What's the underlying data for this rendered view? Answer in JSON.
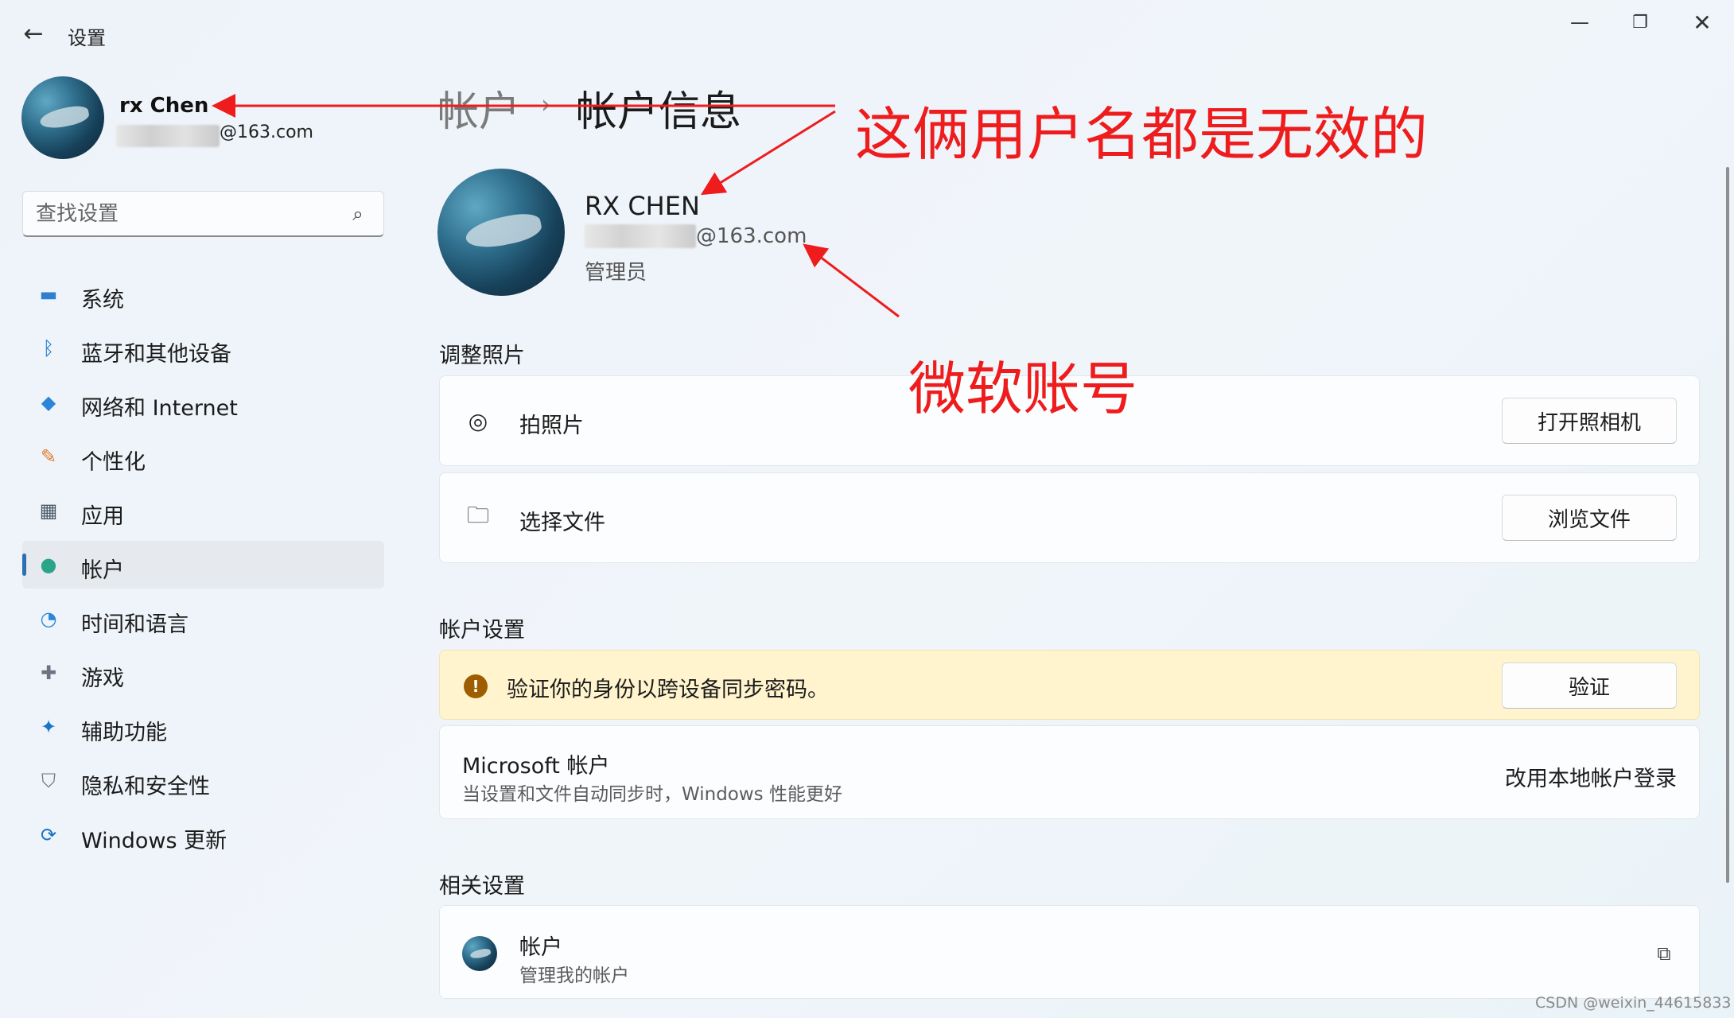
{
  "window": {
    "title": "设置",
    "controls": {
      "minimize": "—",
      "maximize": "❐",
      "close": "✕"
    }
  },
  "user": {
    "name": "rx Chen",
    "email_suffix": "@163.com"
  },
  "search": {
    "placeholder": "查找设置"
  },
  "nav": {
    "items": [
      {
        "label": "系统",
        "icon": "system-icon",
        "glyph": "▬",
        "color": "#2f7fd1"
      },
      {
        "label": "蓝牙和其他设备",
        "icon": "bluetooth-icon",
        "glyph": "ᛒ",
        "color": "#1a73c8"
      },
      {
        "label": "网络和 Internet",
        "icon": "wifi-icon",
        "glyph": "◆",
        "color": "#2a86d8"
      },
      {
        "label": "个性化",
        "icon": "brush-icon",
        "glyph": "✎",
        "color": "#e07a2a"
      },
      {
        "label": "应用",
        "icon": "apps-icon",
        "glyph": "▦",
        "color": "#4a5a6a"
      },
      {
        "label": "帐户",
        "icon": "account-icon",
        "glyph": "●",
        "color": "#2ba58a",
        "active": true
      },
      {
        "label": "时间和语言",
        "icon": "clock-icon",
        "glyph": "◔",
        "color": "#2a86d8"
      },
      {
        "label": "游戏",
        "icon": "gamepad-icon",
        "glyph": "✚",
        "color": "#6a7480"
      },
      {
        "label": "辅助功能",
        "icon": "accessibility-icon",
        "glyph": "✦",
        "color": "#1a73c8"
      },
      {
        "label": "隐私和安全性",
        "icon": "shield-icon",
        "glyph": "⛉",
        "color": "#6a7480"
      },
      {
        "label": "Windows 更新",
        "icon": "update-icon",
        "glyph": "⟳",
        "color": "#1a73c8"
      }
    ]
  },
  "header": {
    "breadcrumb_parent": "帐户",
    "breadcrumb_sep": "›",
    "title": "帐户信息"
  },
  "account": {
    "name": "RX CHEN",
    "email_suffix": "@163.com",
    "role": "管理员"
  },
  "sections": {
    "photo": {
      "title": "调整照片",
      "take_photo": {
        "label": "拍照片",
        "button": "打开照相机"
      },
      "choose_file": {
        "label": "选择文件",
        "button": "浏览文件"
      }
    },
    "account_settings": {
      "title": "帐户设置",
      "verify": {
        "message": "验证你的身份以跨设备同步密码。",
        "button": "验证"
      },
      "microsoft": {
        "title": "Microsoft 帐户",
        "subtitle": "当设置和文件自动同步时，Windows 性能更好",
        "link": "改用本地帐户登录"
      }
    },
    "related": {
      "title": "相关设置",
      "account": {
        "title": "帐户",
        "subtitle": "管理我的帐户"
      }
    }
  },
  "annotations": {
    "top": "这俩用户名都是无效的",
    "bottom": "微软账号",
    "color": "#ee1c1c"
  },
  "watermark": "CSDN @weixin_44615833"
}
